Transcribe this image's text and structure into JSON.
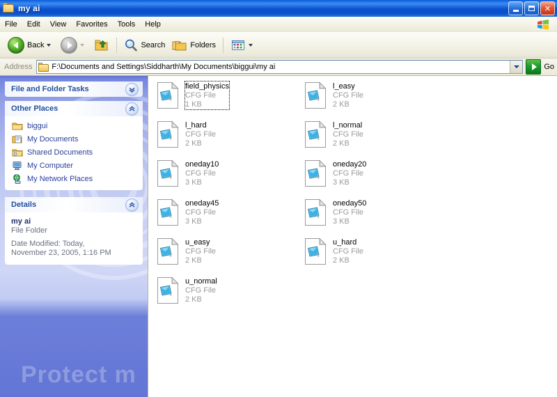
{
  "window": {
    "title": "my ai",
    "title_icon": "folder-icon",
    "buttons": {
      "minimize": "minimize-button",
      "maximize": "restore-button",
      "close": "close-button",
      "close_glyph": "✕"
    }
  },
  "menu": {
    "items": [
      {
        "label": "File"
      },
      {
        "label": "Edit"
      },
      {
        "label": "View"
      },
      {
        "label": "Favorites"
      },
      {
        "label": "Tools"
      },
      {
        "label": "Help"
      }
    ],
    "brand_icon": "windows-flag-icon"
  },
  "toolbar": {
    "back_label": "Back",
    "forward_label": "",
    "up_label": "",
    "search_label": "Search",
    "folders_label": "Folders",
    "views_label": ""
  },
  "address": {
    "label": "Address",
    "path": "F:\\Documents and Settings\\Siddharth\\My Documents\\biggui\\my ai",
    "go_label": "Go"
  },
  "sidebar": {
    "watermark_text": "Protect m",
    "panels": [
      {
        "title": "File and Folder Tasks",
        "state": "collapsed",
        "chevron": "chevron-down-icon",
        "items": []
      },
      {
        "title": "Other Places",
        "state": "expanded",
        "chevron": "chevron-up-icon",
        "items": [
          {
            "label": "biggui",
            "icon": "folder-icon"
          },
          {
            "label": "My Documents",
            "icon": "my-documents-icon"
          },
          {
            "label": "Shared Documents",
            "icon": "shared-documents-icon"
          },
          {
            "label": "My Computer",
            "icon": "my-computer-icon"
          },
          {
            "label": "My Network Places",
            "icon": "my-network-places-icon"
          }
        ]
      },
      {
        "title": "Details",
        "state": "expanded",
        "chevron": "chevron-up-icon",
        "details": {
          "name": "my ai",
          "type": "File Folder",
          "modified": "Date Modified: Today,",
          "modified2": "November 23, 2005, 1:16 PM"
        }
      }
    ]
  },
  "files": [
    {
      "name": "field_physics",
      "type": "CFG File",
      "size": "1 KB",
      "icon": "cfg-file-icon",
      "focused": true,
      "col": 0,
      "row": 0
    },
    {
      "name": "l_easy",
      "type": "CFG File",
      "size": "2 KB",
      "icon": "cfg-file-icon",
      "focused": false,
      "col": 1,
      "row": 0
    },
    {
      "name": "l_hard",
      "type": "CFG File",
      "size": "2 KB",
      "icon": "cfg-file-icon",
      "focused": false,
      "col": 0,
      "row": 1
    },
    {
      "name": "l_normal",
      "type": "CFG File",
      "size": "2 KB",
      "icon": "cfg-file-icon",
      "focused": false,
      "col": 1,
      "row": 1
    },
    {
      "name": "oneday10",
      "type": "CFG File",
      "size": "3 KB",
      "icon": "cfg-file-icon",
      "focused": false,
      "col": 0,
      "row": 2
    },
    {
      "name": "oneday20",
      "type": "CFG File",
      "size": "3 KB",
      "icon": "cfg-file-icon",
      "focused": false,
      "col": 1,
      "row": 2
    },
    {
      "name": "oneday45",
      "type": "CFG File",
      "size": "3 KB",
      "icon": "cfg-file-icon",
      "focused": false,
      "col": 0,
      "row": 3
    },
    {
      "name": "oneday50",
      "type": "CFG File",
      "size": "3 KB",
      "icon": "cfg-file-icon",
      "focused": false,
      "col": 1,
      "row": 3
    },
    {
      "name": "u_easy",
      "type": "CFG File",
      "size": "2 KB",
      "icon": "cfg-file-icon",
      "focused": false,
      "col": 0,
      "row": 4
    },
    {
      "name": "u_hard",
      "type": "CFG File",
      "size": "2 KB",
      "icon": "cfg-file-icon",
      "focused": false,
      "col": 1,
      "row": 4
    },
    {
      "name": "u_normal",
      "type": "CFG File",
      "size": "2 KB",
      "icon": "cfg-file-icon",
      "focused": false,
      "col": 0,
      "row": 5
    }
  ],
  "colors": {
    "title_blue": "#0b51cc",
    "sidebar_blue": "#6375d6",
    "panel_title": "#214f9c",
    "link_blue": "#2a3f9b",
    "meta_grey": "#9a9a9a",
    "close_red": "#c3341b"
  }
}
